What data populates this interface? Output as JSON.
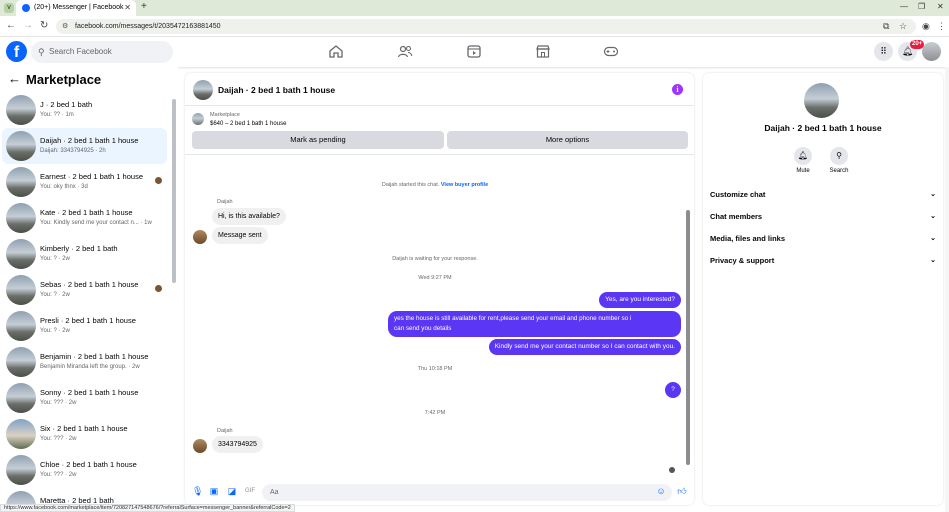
{
  "browser": {
    "tab_title": "(20+) Messenger | Facebook",
    "url": "facebook.com/messages/t/2035472163881450",
    "status_url": "https://www.facebook.com/marketplace/item/720827147548676/?referralSurface=messenger_banner&referralCode=2"
  },
  "header": {
    "search_placeholder": "Search Facebook",
    "notif_badge": "20+"
  },
  "left": {
    "title": "Marketplace",
    "conversations": [
      {
        "name": "J · 2 bed 1 bath",
        "sub": "You: ?? · 1m"
      },
      {
        "name": "Daijah · 2 bed 1 bath 1 house",
        "sub": "Daijah: 3343794925 · 2h"
      },
      {
        "name": "Earnest · 2 bed 1 bath 1 house",
        "sub": "You: oky thnx · 3d"
      },
      {
        "name": "Kate · 2 bed 1 bath 1 house",
        "sub": "You: Kindly send me your contact n... · 1w"
      },
      {
        "name": "Kimberly · 2 bed 1 bath",
        "sub": "You: ? · 2w"
      },
      {
        "name": "Sebas · 2 bed 1 bath 1 house",
        "sub": "You: ? · 2w"
      },
      {
        "name": "Presli · 2 bed 1 bath 1 house",
        "sub": "You: ? · 2w"
      },
      {
        "name": "Benjamin · 2 bed 1 bath 1 house",
        "sub": "Benjamin Miranda left the group. · 2w"
      },
      {
        "name": "Sonny · 2 bed 1 bath 1 house",
        "sub": "You: ??? · 2w"
      },
      {
        "name": "Six · 2 bed 1 bath 1 house",
        "sub": "You: ??? · 2w"
      },
      {
        "name": "Chloe · 2 bed 1 bath 1 house",
        "sub": "You: ??? · 2w"
      },
      {
        "name": "Maretta · 2 bed 1 bath",
        "sub": ""
      }
    ]
  },
  "chat": {
    "title": "Daijah · 2 bed 1 bath 1 house",
    "marketplace_label": "Marketplace",
    "listing_price": "$640 – 2 bed 1 bath 1 house",
    "pending_btn": "Mark as pending",
    "options_btn": "More options",
    "started_note": "Daijah started this chat.",
    "view_profile_link": "View buyer profile",
    "sender_name": "Daijah",
    "in1": "Hi, is this available?",
    "in2": "Message sent",
    "waiting_note": "Daijah is waiting for your response.",
    "time1": "Wed 9:27 PM",
    "out1": "Yes, are you interested?",
    "out2_line1": "yes the house is still available for rent,please send your email and phone number so i",
    "out2_line2": "can send you details",
    "out3": "Kindly send me your contact number so I can contact with you.",
    "time2": "Thu 10:18 PM",
    "out4": "?",
    "time3": "7:42 PM",
    "sender_name2": "Daijah",
    "in3": "3343794925",
    "input_placeholder": "Aa"
  },
  "right": {
    "name": "Daijah · 2 bed 1 bath 1 house",
    "mute_label": "Mute",
    "search_label": "Search",
    "rows": [
      "Customize chat",
      "Chat members",
      "Media, files and links",
      "Privacy & support"
    ]
  },
  "colors": {
    "accent": "#0866ff",
    "outgoing_bubble": "#5b37f5",
    "info_icon": "#a033ff"
  }
}
